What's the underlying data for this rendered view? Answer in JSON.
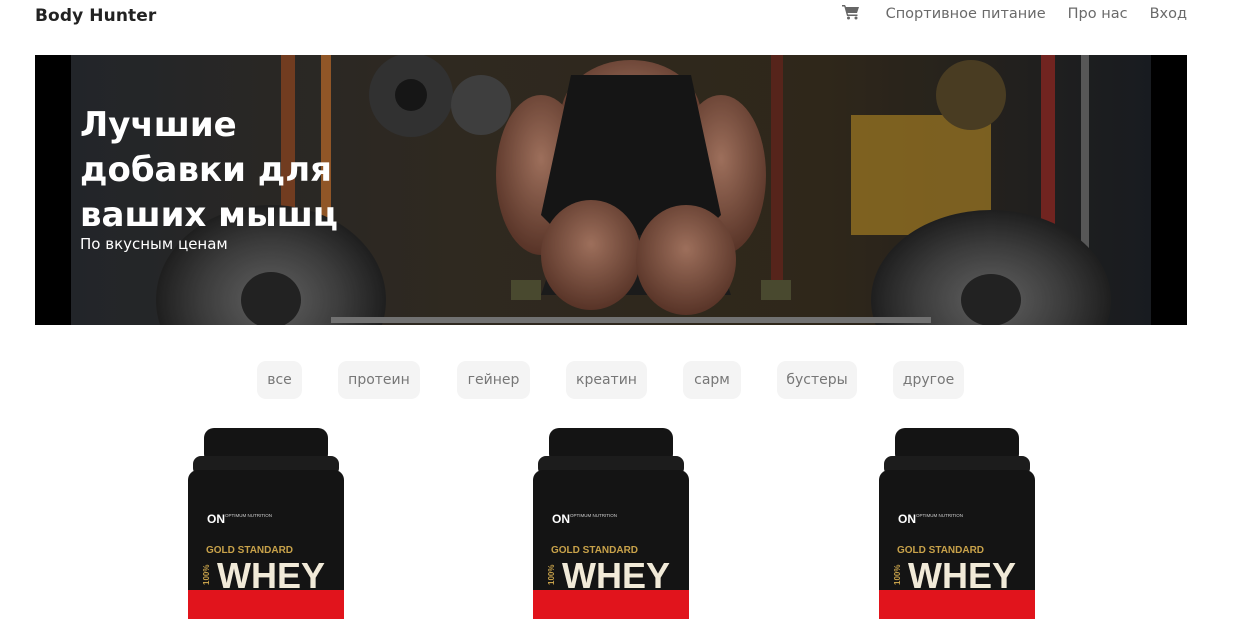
{
  "header": {
    "brand": "Body Hunter",
    "cart_icon": "shopping-cart-icon",
    "nav": [
      {
        "label": "Спортивное питание"
      },
      {
        "label": "Про нас"
      },
      {
        "label": "Вход"
      }
    ]
  },
  "hero": {
    "title": "Лучшие добавки для ваших мышц",
    "subtitle": "По вкусным ценам"
  },
  "filters": [
    {
      "label": "все"
    },
    {
      "label": "протеин"
    },
    {
      "label": "гейнер"
    },
    {
      "label": "креатин"
    },
    {
      "label": "сарм"
    },
    {
      "label": "бустеры"
    },
    {
      "label": "другое"
    }
  ],
  "products": [
    {
      "brand_small": "OPTIMUM NUTRITION",
      "line": "GOLD STANDARD",
      "percent": "100%",
      "name": "WHEY"
    },
    {
      "brand_small": "OPTIMUM NUTRITION",
      "line": "GOLD STANDARD",
      "percent": "100%",
      "name": "WHEY"
    },
    {
      "brand_small": "OPTIMUM NUTRITION",
      "line": "GOLD STANDARD",
      "percent": "100%",
      "name": "WHEY"
    }
  ],
  "colors": {
    "accent_red": "#e1141c",
    "tub_black": "#141414",
    "gold": "#c8a24a"
  }
}
